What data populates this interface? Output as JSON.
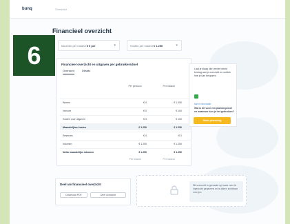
{
  "badge": "6",
  "topbar": {
    "logo": "bunq",
    "nav_item": "Overzicht"
  },
  "page_title": "Financieel overzicht",
  "filters": [
    {
      "label": "Inkomen per maand",
      "value": "€ 0 per",
      "icon": "chevron-down-icon"
    },
    {
      "label": "Kosten per maand",
      "value": "€ 1.250",
      "icon": "chevron-down-icon"
    }
  ],
  "main_card": {
    "title": "Financieel overzicht en uitgaven per gebruikersdoel",
    "tabs": [
      "Overzicht",
      "Details"
    ],
    "col_headers": [
      "Per persoon",
      "Per maand"
    ],
    "rows": [
      {
        "label": "Wonen",
        "a": "€ 0",
        "b": "€ 1.050",
        "bold": false,
        "hl": false
      },
      {
        "label": "Vervoer",
        "a": "€ 0",
        "b": "€ 100",
        "bold": false,
        "hl": false
      },
      {
        "label": "Kosten voor uitgaven",
        "a": "€ 0",
        "b": "€ 100",
        "bold": false,
        "hl": false
      },
      {
        "label": "Maandelijkse kosten",
        "a": "€ 1.250",
        "b": "€ 1.250",
        "bold": true,
        "hl": true
      },
      {
        "label": "Reserves",
        "a": "€ 0",
        "b": "€ 0",
        "bold": false,
        "hl": false
      },
      {
        "label": "Inkomen",
        "a": "€ 1.250",
        "b": "€ 1.250",
        "bold": false,
        "hl": false
      },
      {
        "label": "Netto maandelijks inkomen",
        "a": "€ 1.250",
        "b": "€ 1.250",
        "bold": true,
        "hl": false
      }
    ],
    "footer": [
      "Per maand",
      "Per maand"
    ]
  },
  "side_card": {
    "text1": "Laat je klaag hier verder beleid bedrag aan je overzicht en ontdek hoe je kan besparen",
    "link": "Meer informatie",
    "text2": "Wat is dit voor een planningstool en waarvoor kun je het gebruiken?",
    "cta": "Start planning"
  },
  "bottom_card": {
    "title": "Deel uw financieel overzicht",
    "buttons": [
      "Download PDF",
      "Deel overzicht"
    ]
  },
  "info_text": "Dit overzicht is gemaakt op basis van de ingevulde gegevens en is alleen zichtbaar voor jou",
  "colors": {
    "badge": "#1d5427",
    "cta": "#f6b81f",
    "toggle": "#3aa84d",
    "page_bg": "#d4e5b8"
  }
}
